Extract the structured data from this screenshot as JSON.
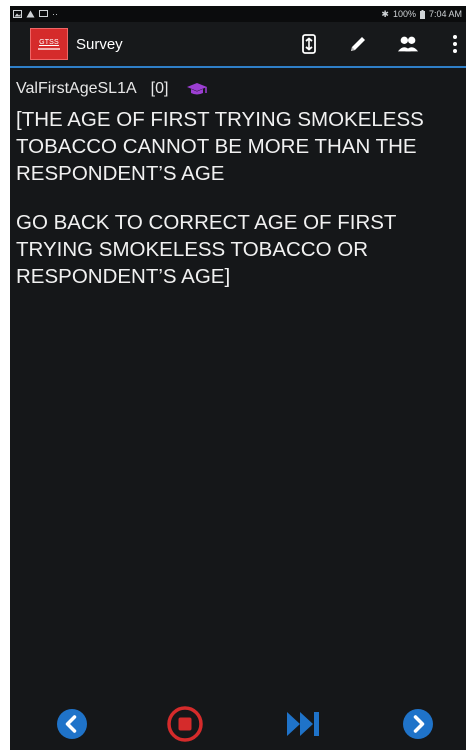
{
  "status_bar": {
    "battery": "100%",
    "time": "7:04 AM",
    "icons": [
      "image-icon",
      "warning-icon",
      "screen-icon",
      "more-dots-icon",
      "bluetooth-icon",
      "battery-icon"
    ]
  },
  "app_bar": {
    "logo_text": "GTSS",
    "title": "Survey",
    "actions": [
      "jump-icon",
      "edit-pencil-icon",
      "respondents-icon",
      "overflow-menu-icon"
    ]
  },
  "question": {
    "id": "ValFirstAgeSL1A",
    "index": "[0]",
    "icon": "graduation-cap-icon",
    "message_lines_1": [
      "[THE AGE OF FIRST TRYING SMOKELESS",
      "TOBACCO CANNOT BE MORE THAN THE",
      "RESPONDENT’S AGE"
    ],
    "message_lines_2": [
      "GO BACK TO CORRECT AGE OF FIRST",
      "TRYING SMOKELESS TOBACCO OR",
      "RESPONDENT’S AGE]"
    ]
  },
  "nav": {
    "buttons": [
      "previous-icon",
      "stop-icon",
      "fast-forward-icon",
      "next-icon"
    ]
  },
  "colors": {
    "background": "#151719",
    "accent_blue": "#1f73c9",
    "accent_red": "#d52b2b",
    "graduation_purple": "#9c3fd3"
  }
}
